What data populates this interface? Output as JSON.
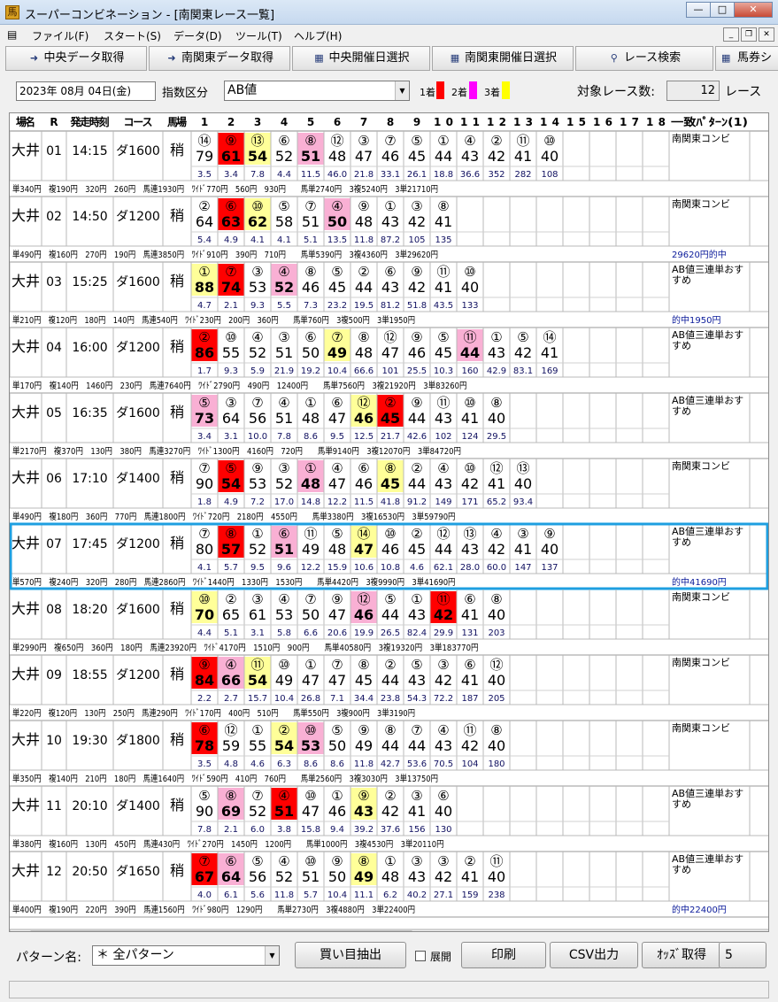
{
  "window": {
    "title": "スーパーコンビネーション - [南関東レース一覧]"
  },
  "menu": [
    "ファイル(F)",
    "スタート(S)",
    "データ(D)",
    "ツール(T)",
    "ヘルプ(H)"
  ],
  "toolbar": [
    "中央データ取得",
    "南関東データ取得",
    "中央開催日選択",
    "南関東開催日選択",
    "レース検索",
    "馬券シ"
  ],
  "filter": {
    "date": "2023年 08月 04日(金)",
    "index_label": "指数区分",
    "index_value": "AB値",
    "first": "1着",
    "second": "2着",
    "third": "3着",
    "target_label": "対象レース数:",
    "target_count": "12",
    "target_unit": "レース"
  },
  "colors": {
    "first": "#ff0000",
    "second": "#ff00ff",
    "third": "#ffff00",
    "first_cell": "#ff0000",
    "second_cell": "#f9b0d4",
    "third_cell": "#ffff99",
    "highlight": "#1e9fe0"
  },
  "headers": [
    "場名",
    "R",
    "発走時刻",
    "コース",
    "馬場",
    "1",
    "2",
    "3",
    "4",
    "5",
    "6",
    "7",
    "8",
    "9",
    "10",
    "11",
    "12",
    "13",
    "14",
    "15",
    "16",
    "17",
    "18",
    "一致ﾊﾟﾀｰﾝ(1)"
  ],
  "races": [
    {
      "venue": "大井",
      "r": "01",
      "time": "14:15",
      "course": "ダ1600",
      "cond": "稍",
      "horses": [
        {
          "no": "⑭",
          "ab": "79",
          "odds": "3.5"
        },
        {
          "no": "⑨",
          "ab": "61",
          "odds": "3.4",
          "p": 1
        },
        {
          "no": "⑬",
          "ab": "54",
          "odds": "7.8",
          "p": 3
        },
        {
          "no": "⑥",
          "ab": "52",
          "odds": "4.4"
        },
        {
          "no": "⑧",
          "ab": "51",
          "odds": "11.5",
          "p": 2
        },
        {
          "no": "⑫",
          "ab": "48",
          "odds": "46.0"
        },
        {
          "no": "③",
          "ab": "47",
          "odds": "21.8"
        },
        {
          "no": "⑦",
          "ab": "46",
          "odds": "33.1"
        },
        {
          "no": "⑤",
          "ab": "45",
          "odds": "26.1"
        },
        {
          "no": "①",
          "ab": "44",
          "odds": "18.8"
        },
        {
          "no": "④",
          "ab": "43",
          "odds": "36.6"
        },
        {
          "no": "②",
          "ab": "42",
          "odds": "352"
        },
        {
          "no": "⑪",
          "ab": "41",
          "odds": "282"
        },
        {
          "no": "⑩",
          "ab": "40",
          "odds": "108"
        }
      ],
      "pattern": "南関東コンビ",
      "payout": "単340円　複190円　320円　260円　馬連1930円　ﾜｲﾄﾞ770円　560円　930円　　馬単2740円　3複5240円　3単21710円",
      "hit": ""
    },
    {
      "venue": "大井",
      "r": "02",
      "time": "14:50",
      "course": "ダ1200",
      "cond": "稍",
      "horses": [
        {
          "no": "②",
          "ab": "64",
          "odds": "5.4"
        },
        {
          "no": "⑥",
          "ab": "63",
          "odds": "4.9",
          "p": 1
        },
        {
          "no": "⑩",
          "ab": "62",
          "odds": "4.1",
          "p": 3
        },
        {
          "no": "⑤",
          "ab": "58",
          "odds": "4.1"
        },
        {
          "no": "⑦",
          "ab": "51",
          "odds": "5.1"
        },
        {
          "no": "④",
          "ab": "50",
          "odds": "13.5",
          "p": 2
        },
        {
          "no": "⑨",
          "ab": "48",
          "odds": "11.8"
        },
        {
          "no": "①",
          "ab": "43",
          "odds": "87.2"
        },
        {
          "no": "③",
          "ab": "42",
          "odds": "105"
        },
        {
          "no": "⑧",
          "ab": "41",
          "odds": "135"
        }
      ],
      "pattern": "南関東コンビ",
      "payout": "単490円　複160円　270円　190円　馬連3850円　ﾜｲﾄﾞ910円　390円　710円　　馬単5390円　3複4360円　3単29620円",
      "hit": "29620円的中"
    },
    {
      "venue": "大井",
      "r": "03",
      "time": "15:25",
      "course": "ダ1600",
      "cond": "稍",
      "horses": [
        {
          "no": "①",
          "ab": "88",
          "odds": "4.7",
          "p": 3
        },
        {
          "no": "⑦",
          "ab": "74",
          "odds": "2.1",
          "p": 1
        },
        {
          "no": "③",
          "ab": "53",
          "odds": "9.3"
        },
        {
          "no": "④",
          "ab": "52",
          "odds": "5.5",
          "p": 2
        },
        {
          "no": "⑧",
          "ab": "46",
          "odds": "7.3"
        },
        {
          "no": "⑤",
          "ab": "45",
          "odds": "23.2"
        },
        {
          "no": "②",
          "ab": "44",
          "odds": "19.5"
        },
        {
          "no": "⑥",
          "ab": "43",
          "odds": "81.2"
        },
        {
          "no": "⑨",
          "ab": "42",
          "odds": "51.8"
        },
        {
          "no": "⑪",
          "ab": "41",
          "odds": "43.5"
        },
        {
          "no": "⑩",
          "ab": "40",
          "odds": "133"
        }
      ],
      "pattern": "AB値三連単おすすめ",
      "payout": "単210円　複120円　180円　140円　馬連540円　ﾜｲﾄﾞ230円　200円　360円　　馬単760円　3複500円　3単1950円",
      "hit": "的中1950円"
    },
    {
      "venue": "大井",
      "r": "04",
      "time": "16:00",
      "course": "ダ1200",
      "cond": "稍",
      "horses": [
        {
          "no": "②",
          "ab": "86",
          "odds": "1.7",
          "p": 1
        },
        {
          "no": "⑩",
          "ab": "55",
          "odds": "9.3"
        },
        {
          "no": "④",
          "ab": "52",
          "odds": "5.9"
        },
        {
          "no": "③",
          "ab": "51",
          "odds": "21.9"
        },
        {
          "no": "⑥",
          "ab": "50",
          "odds": "19.2"
        },
        {
          "no": "⑦",
          "ab": "49",
          "odds": "10.4",
          "p": 3
        },
        {
          "no": "⑧",
          "ab": "48",
          "odds": "66.6"
        },
        {
          "no": "⑫",
          "ab": "47",
          "odds": "101"
        },
        {
          "no": "⑨",
          "ab": "46",
          "odds": "25.5"
        },
        {
          "no": "⑤",
          "ab": "45",
          "odds": "10.3"
        },
        {
          "no": "⑪",
          "ab": "44",
          "odds": "160",
          "p": 2
        },
        {
          "no": "①",
          "ab": "43",
          "odds": "42.9"
        },
        {
          "no": "⑤",
          "ab": "42",
          "odds": "83.1"
        },
        {
          "no": "⑭",
          "ab": "41",
          "odds": "169"
        }
      ],
      "pattern": "AB値三連単おすすめ",
      "payout": "単170円　複140円　1460円　230円　馬連7640円　ﾜｲﾄﾞ2790円　490円　12400円　　馬単7560円　3複21920円　3単83260円",
      "hit": ""
    },
    {
      "venue": "大井",
      "r": "05",
      "time": "16:35",
      "course": "ダ1600",
      "cond": "稍",
      "horses": [
        {
          "no": "⑤",
          "ab": "73",
          "odds": "3.4",
          "p": 2
        },
        {
          "no": "③",
          "ab": "64",
          "odds": "3.1"
        },
        {
          "no": "⑦",
          "ab": "56",
          "odds": "10.0"
        },
        {
          "no": "④",
          "ab": "51",
          "odds": "7.8"
        },
        {
          "no": "①",
          "ab": "48",
          "odds": "8.6"
        },
        {
          "no": "⑥",
          "ab": "47",
          "odds": "9.5"
        },
        {
          "no": "⑫",
          "ab": "46",
          "odds": "12.5",
          "p": 3
        },
        {
          "no": "②",
          "ab": "45",
          "odds": "21.7",
          "p": 1
        },
        {
          "no": "⑨",
          "ab": "44",
          "odds": "42.6"
        },
        {
          "no": "⑪",
          "ab": "43",
          "odds": "102"
        },
        {
          "no": "⑩",
          "ab": "41",
          "odds": "124"
        },
        {
          "no": "⑧",
          "ab": "40",
          "odds": "29.5"
        }
      ],
      "pattern": "AB値三連単おすすめ",
      "payout": "単2170円　複370円　130円　380円　馬連3270円　ﾜｲﾄﾞ1300円　4160円　720円　　馬単9140円　3複12070円　3単84720円",
      "hit": ""
    },
    {
      "venue": "大井",
      "r": "06",
      "time": "17:10",
      "course": "ダ1400",
      "cond": "稍",
      "horses": [
        {
          "no": "⑦",
          "ab": "90",
          "odds": "1.8"
        },
        {
          "no": "⑤",
          "ab": "54",
          "odds": "4.9",
          "p": 1
        },
        {
          "no": "⑨",
          "ab": "53",
          "odds": "7.2"
        },
        {
          "no": "③",
          "ab": "52",
          "odds": "17.0"
        },
        {
          "no": "①",
          "ab": "48",
          "odds": "14.8",
          "p": 2
        },
        {
          "no": "④",
          "ab": "47",
          "odds": "12.2"
        },
        {
          "no": "⑥",
          "ab": "46",
          "odds": "11.5"
        },
        {
          "no": "⑧",
          "ab": "45",
          "odds": "41.8",
          "p": 3
        },
        {
          "no": "②",
          "ab": "44",
          "odds": "91.2"
        },
        {
          "no": "④",
          "ab": "43",
          "odds": "149"
        },
        {
          "no": "⑩",
          "ab": "42",
          "odds": "171"
        },
        {
          "no": "⑫",
          "ab": "41",
          "odds": "65.2"
        },
        {
          "no": "⑬",
          "ab": "40",
          "odds": "93.4"
        }
      ],
      "pattern": "南関東コンビ",
      "payout": "単490円　複180円　360円　770円　馬連1800円　ﾜｲﾄﾞ720円　2180円　4550円　　馬単3380円　3複16530円　3単59790円",
      "hit": ""
    },
    {
      "venue": "大井",
      "r": "07",
      "time": "17:45",
      "course": "ダ1200",
      "cond": "稍",
      "sel": true,
      "horses": [
        {
          "no": "⑦",
          "ab": "80",
          "odds": "4.1"
        },
        {
          "no": "⑧",
          "ab": "57",
          "odds": "5.7",
          "p": 1
        },
        {
          "no": "①",
          "ab": "52",
          "odds": "9.5"
        },
        {
          "no": "⑥",
          "ab": "51",
          "odds": "9.6",
          "p": 2
        },
        {
          "no": "⑪",
          "ab": "49",
          "odds": "12.2"
        },
        {
          "no": "⑤",
          "ab": "48",
          "odds": "15.9"
        },
        {
          "no": "⑭",
          "ab": "47",
          "odds": "10.6",
          "p": 3
        },
        {
          "no": "⑩",
          "ab": "46",
          "odds": "10.8"
        },
        {
          "no": "②",
          "ab": "45",
          "odds": "4.6"
        },
        {
          "no": "⑫",
          "ab": "44",
          "odds": "62.1"
        },
        {
          "no": "⑬",
          "ab": "43",
          "odds": "28.0"
        },
        {
          "no": "④",
          "ab": "42",
          "odds": "60.0"
        },
        {
          "no": "③",
          "ab": "41",
          "odds": "147"
        },
        {
          "no": "⑨",
          "ab": "40",
          "odds": "137"
        }
      ],
      "pattern": "AB値三連単おすすめ",
      "payout": "単570円　複240円　320円　280円　馬連2860円　ﾜｲﾄﾞ1440円　1330円　1530円　　馬単4420円　3複9990円　3単41690円",
      "hit": "的中41690円"
    },
    {
      "venue": "大井",
      "r": "08",
      "time": "18:20",
      "course": "ダ1600",
      "cond": "稍",
      "horses": [
        {
          "no": "⑩",
          "ab": "70",
          "odds": "4.4",
          "p": 3
        },
        {
          "no": "②",
          "ab": "65",
          "odds": "5.1"
        },
        {
          "no": "③",
          "ab": "61",
          "odds": "3.1"
        },
        {
          "no": "④",
          "ab": "53",
          "odds": "5.8"
        },
        {
          "no": "⑦",
          "ab": "50",
          "odds": "6.6"
        },
        {
          "no": "⑨",
          "ab": "47",
          "odds": "20.6"
        },
        {
          "no": "⑫",
          "ab": "46",
          "odds": "19.9",
          "p": 2
        },
        {
          "no": "⑤",
          "ab": "44",
          "odds": "26.5"
        },
        {
          "no": "①",
          "ab": "43",
          "odds": "82.4"
        },
        {
          "no": "⑪",
          "ab": "42",
          "odds": "29.9",
          "p": 1
        },
        {
          "no": "⑥",
          "ab": "41",
          "odds": "131"
        },
        {
          "no": "⑧",
          "ab": "40",
          "odds": "203"
        }
      ],
      "pattern": "南関東コンビ",
      "payout": "単2990円　複650円　360円　180円　馬連23920円　ﾜｲﾄﾞ4170円　1510円　900円　　馬単40580円　3複19320円　3単183770円",
      "hit": ""
    },
    {
      "venue": "大井",
      "r": "09",
      "time": "18:55",
      "course": "ダ1200",
      "cond": "稍",
      "horses": [
        {
          "no": "⑨",
          "ab": "84",
          "odds": "2.2",
          "p": 1
        },
        {
          "no": "④",
          "ab": "66",
          "odds": "2.7",
          "p": 2
        },
        {
          "no": "⑪",
          "ab": "54",
          "odds": "15.7",
          "p": 3
        },
        {
          "no": "⑩",
          "ab": "49",
          "odds": "10.4"
        },
        {
          "no": "①",
          "ab": "47",
          "odds": "26.8"
        },
        {
          "no": "⑦",
          "ab": "47",
          "odds": "7.1"
        },
        {
          "no": "⑧",
          "ab": "45",
          "odds": "34.4"
        },
        {
          "no": "②",
          "ab": "44",
          "odds": "23.8"
        },
        {
          "no": "⑤",
          "ab": "43",
          "odds": "54.3"
        },
        {
          "no": "③",
          "ab": "42",
          "odds": "72.2"
        },
        {
          "no": "⑥",
          "ab": "41",
          "odds": "187"
        },
        {
          "no": "⑫",
          "ab": "40",
          "odds": "205"
        }
      ],
      "pattern": "南関東コンビ",
      "payout": "単220円　複120円　130円　250円　馬連290円　ﾜｲﾄﾞ170円　400円　510円　　馬単550円　3複900円　3単3190円",
      "hit": ""
    },
    {
      "venue": "大井",
      "r": "10",
      "time": "19:30",
      "course": "ダ1800",
      "cond": "稍",
      "horses": [
        {
          "no": "⑥",
          "ab": "78",
          "odds": "3.5",
          "p": 1
        },
        {
          "no": "⑫",
          "ab": "59",
          "odds": "4.8"
        },
        {
          "no": "①",
          "ab": "55",
          "odds": "4.6"
        },
        {
          "no": "②",
          "ab": "54",
          "odds": "6.3",
          "p": 3
        },
        {
          "no": "⑩",
          "ab": "53",
          "odds": "8.6",
          "p": 2
        },
        {
          "no": "⑤",
          "ab": "50",
          "odds": "8.6"
        },
        {
          "no": "⑨",
          "ab": "49",
          "odds": "11.8"
        },
        {
          "no": "⑧",
          "ab": "44",
          "odds": "42.7"
        },
        {
          "no": "⑦",
          "ab": "44",
          "odds": "53.6"
        },
        {
          "no": "④",
          "ab": "43",
          "odds": "70.5"
        },
        {
          "no": "⑪",
          "ab": "42",
          "odds": "104"
        },
        {
          "no": "⑧",
          "ab": "40",
          "odds": "180"
        }
      ],
      "pattern": "南関東コンビ",
      "payout": "単350円　複140円　210円　180円　馬連1640円　ﾜｲﾄﾞ590円　410円　760円　　馬単2560円　3複3030円　3単13750円",
      "hit": ""
    },
    {
      "venue": "大井",
      "r": "11",
      "time": "20:10",
      "course": "ダ1400",
      "cond": "稍",
      "horses": [
        {
          "no": "⑤",
          "ab": "90",
          "odds": "7.8"
        },
        {
          "no": "⑧",
          "ab": "69",
          "odds": "2.1",
          "p": 2
        },
        {
          "no": "⑦",
          "ab": "52",
          "odds": "6.0"
        },
        {
          "no": "④",
          "ab": "51",
          "odds": "3.8",
          "p": 1
        },
        {
          "no": "⑩",
          "ab": "47",
          "odds": "15.8"
        },
        {
          "no": "①",
          "ab": "46",
          "odds": "9.4"
        },
        {
          "no": "⑨",
          "ab": "43",
          "odds": "39.2",
          "p": 3
        },
        {
          "no": "②",
          "ab": "42",
          "odds": "37.6"
        },
        {
          "no": "③",
          "ab": "41",
          "odds": "156"
        },
        {
          "no": "⑥",
          "ab": "40",
          "odds": "130"
        }
      ],
      "pattern": "AB値三連単おすすめ",
      "payout": "単380円　複160円　130円　450円　馬連430円　ﾜｲﾄﾞ270円　1450円　1200円　　馬単1000円　3複4530円　3単20110円",
      "hit": ""
    },
    {
      "venue": "大井",
      "r": "12",
      "time": "20:50",
      "course": "ダ1650",
      "cond": "稍",
      "horses": [
        {
          "no": "⑦",
          "ab": "67",
          "odds": "4.0",
          "p": 1
        },
        {
          "no": "⑥",
          "ab": "64",
          "odds": "6.1",
          "p": 2
        },
        {
          "no": "⑤",
          "ab": "56",
          "odds": "5.6"
        },
        {
          "no": "④",
          "ab": "52",
          "odds": "11.8"
        },
        {
          "no": "⑩",
          "ab": "51",
          "odds": "5.7"
        },
        {
          "no": "⑨",
          "ab": "50",
          "odds": "10.4"
        },
        {
          "no": "⑧",
          "ab": "49",
          "odds": "11.1",
          "p": 3
        },
        {
          "no": "①",
          "ab": "48",
          "odds": "6.2"
        },
        {
          "no": "③",
          "ab": "43",
          "odds": "40.2"
        },
        {
          "no": "③",
          "ab": "42",
          "odds": "27.1"
        },
        {
          "no": "②",
          "ab": "41",
          "odds": "159"
        },
        {
          "no": "⑪",
          "ab": "40",
          "odds": "238"
        }
      ],
      "pattern": "AB値三連単おすすめ",
      "payout": "単400円　複190円　220円　390円　馬連1560円　ﾜｲﾄﾞ980円　1290円　　馬単2730円　3複4880円　3単22400円",
      "hit": "的中22400円"
    }
  ],
  "bottom": {
    "pattern_label": "パターン名:",
    "pattern_value": "＊ 全パターン",
    "extract": "買い目抽出",
    "expand": "展開",
    "print": "印刷",
    "csv": "CSV出力",
    "odds": "ｵｯｽﾞ取得",
    "odds_suffix": "5"
  }
}
